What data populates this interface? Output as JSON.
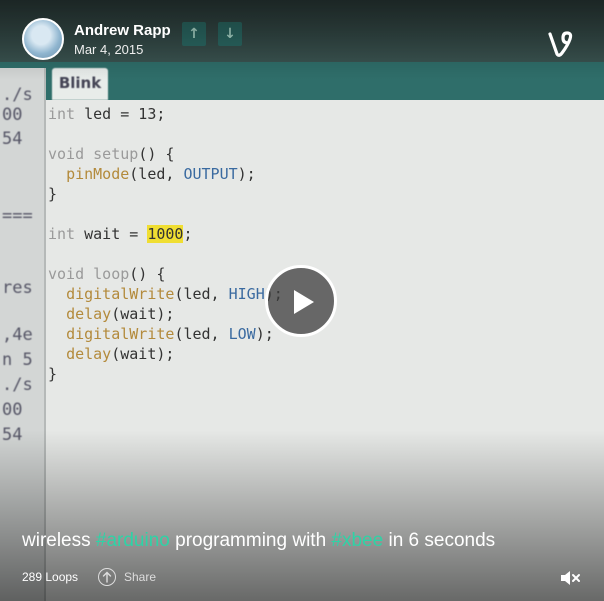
{
  "post": {
    "author": "Andrew Rapp",
    "date": "Mar 4, 2015",
    "caption_parts": [
      {
        "text": "wireless ",
        "tag": false
      },
      {
        "text": "#arduino",
        "tag": true
      },
      {
        "text": " programming with ",
        "tag": false
      },
      {
        "text": "#xbee",
        "tag": true
      },
      {
        "text": " in 6 seconds",
        "tag": false
      }
    ],
    "loops": "289 Loops",
    "share_label": "Share"
  },
  "icons": {
    "brand": "vine-logo-icon",
    "play": "play-icon",
    "share": "share-arrow-icon",
    "mute": "speaker-muted-icon"
  },
  "colors": {
    "hashtag": "#2ed3a6",
    "ide_teal": "#2f6e6a",
    "highlight": "#f0de32"
  },
  "video_frame": {
    "tab_label": "Blink",
    "code_lines": [
      [
        {
          "t": "int",
          "c": "kw"
        },
        {
          "t": " led = 13;"
        }
      ],
      [],
      [
        {
          "t": "void",
          "c": "kw"
        },
        {
          "t": " "
        },
        {
          "t": "setup",
          "c": "kw"
        },
        {
          "t": "() {"
        }
      ],
      [
        {
          "t": "  "
        },
        {
          "t": "pinMode",
          "c": "fn"
        },
        {
          "t": "(led, "
        },
        {
          "t": "OUTPUT",
          "c": "cn"
        },
        {
          "t": ");"
        }
      ],
      [
        {
          "t": "}"
        }
      ],
      [],
      [
        {
          "t": "int",
          "c": "kw"
        },
        {
          "t": " wait = "
        },
        {
          "t": "1000",
          "c": "hl"
        },
        {
          "t": ";"
        }
      ],
      [],
      [
        {
          "t": "void",
          "c": "kw"
        },
        {
          "t": " "
        },
        {
          "t": "loop",
          "c": "kw"
        },
        {
          "t": "() {"
        }
      ],
      [
        {
          "t": "  "
        },
        {
          "t": "digitalWrite",
          "c": "fn"
        },
        {
          "t": "(led, "
        },
        {
          "t": "HIGH",
          "c": "cn"
        },
        {
          "t": ");"
        }
      ],
      [
        {
          "t": "  "
        },
        {
          "t": "delay",
          "c": "fn"
        },
        {
          "t": "(wait);"
        }
      ],
      [
        {
          "t": "  "
        },
        {
          "t": "digitalWrite",
          "c": "fn"
        },
        {
          "t": "(led, "
        },
        {
          "t": "LOW",
          "c": "cn"
        },
        {
          "t": ");"
        }
      ],
      [
        {
          "t": "  "
        },
        {
          "t": "delay",
          "c": "fn"
        },
        {
          "t": "(wait);"
        }
      ],
      [
        {
          "t": "}"
        }
      ]
    ],
    "console_fragments": [
      "./s",
      "00",
      "54",
      "===",
      "res",
      ",4e",
      "n 5",
      "./s",
      "00",
      "54"
    ]
  }
}
